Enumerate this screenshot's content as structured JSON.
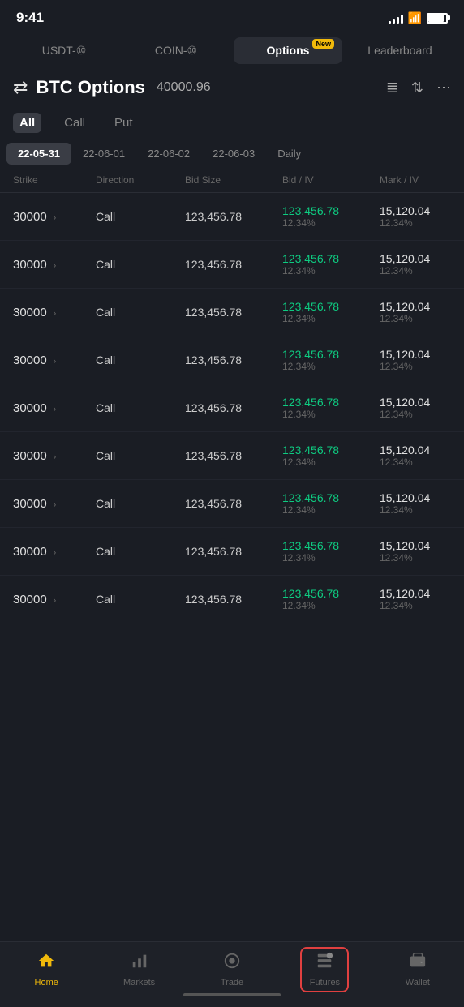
{
  "statusBar": {
    "time": "9:41",
    "signal": [
      3,
      5,
      8,
      11,
      14
    ],
    "battery": 85
  },
  "topTabs": [
    {
      "id": "usdt",
      "label": "USDT-⑩",
      "active": false,
      "badge": null
    },
    {
      "id": "coin",
      "label": "COIN-⑩",
      "active": false,
      "badge": null
    },
    {
      "id": "options",
      "label": "Options",
      "active": true,
      "badge": "New"
    },
    {
      "id": "leaderboard",
      "label": "Leaderboard",
      "active": false,
      "badge": null
    }
  ],
  "header": {
    "title": "BTC Options",
    "price": "40000.96"
  },
  "filterTabs": [
    {
      "label": "All",
      "active": true
    },
    {
      "label": "Call",
      "active": false
    },
    {
      "label": "Put",
      "active": false
    }
  ],
  "dateTabs": [
    {
      "label": "22-05-31",
      "active": true
    },
    {
      "label": "22-06-01",
      "active": false
    },
    {
      "label": "22-06-02",
      "active": false
    },
    {
      "label": "22-06-03",
      "active": false
    },
    {
      "label": "Daily",
      "active": false
    }
  ],
  "tableHeaders": [
    "Strike",
    "Direction",
    "Bid Size",
    "Bid / IV",
    "Mark / IV"
  ],
  "tableRows": [
    {
      "strike": "30000",
      "direction": "Call",
      "bidSize": "123,456.78",
      "bidIV": "123,456.78",
      "bidPct": "12.34%",
      "markIV": "15,120.04",
      "markPct": "12.34%"
    },
    {
      "strike": "30000",
      "direction": "Call",
      "bidSize": "123,456.78",
      "bidIV": "123,456.78",
      "bidPct": "12.34%",
      "markIV": "15,120.04",
      "markPct": "12.34%"
    },
    {
      "strike": "30000",
      "direction": "Call",
      "bidSize": "123,456.78",
      "bidIV": "123,456.78",
      "bidPct": "12.34%",
      "markIV": "15,120.04",
      "markPct": "12.34%"
    },
    {
      "strike": "30000",
      "direction": "Call",
      "bidSize": "123,456.78",
      "bidIV": "123,456.78",
      "bidPct": "12.34%",
      "markIV": "15,120.04",
      "markPct": "12.34%"
    },
    {
      "strike": "30000",
      "direction": "Call",
      "bidSize": "123,456.78",
      "bidIV": "123,456.78",
      "bidPct": "12.34%",
      "markIV": "15,120.04",
      "markPct": "12.34%"
    },
    {
      "strike": "30000",
      "direction": "Call",
      "bidSize": "123,456.78",
      "bidIV": "123,456.78",
      "bidPct": "12.34%",
      "markIV": "15,120.04",
      "markPct": "12.34%"
    },
    {
      "strike": "30000",
      "direction": "Call",
      "bidSize": "123,456.78",
      "bidIV": "123,456.78",
      "bidPct": "12.34%",
      "markIV": "15,120.04",
      "markPct": "12.34%"
    },
    {
      "strike": "30000",
      "direction": "Call",
      "bidSize": "123,456.78",
      "bidIV": "123,456.78",
      "bidPct": "12.34%",
      "markIV": "15,120.04",
      "markPct": "12.34%"
    },
    {
      "strike": "30000",
      "direction": "Call",
      "bidSize": "123,456.78",
      "bidIV": "123,456.78",
      "bidPct": "12.34%",
      "markIV": "15,120.04",
      "markPct": "12.34%"
    }
  ],
  "bottomNav": [
    {
      "id": "home",
      "label": "Home",
      "icon": "🏠",
      "active": true,
      "highlighted": false
    },
    {
      "id": "markets",
      "label": "Markets",
      "icon": "📊",
      "active": false,
      "highlighted": false
    },
    {
      "id": "trade",
      "label": "Trade",
      "icon": "🔄",
      "active": false,
      "highlighted": false
    },
    {
      "id": "futures",
      "label": "Futures",
      "icon": "📋",
      "active": false,
      "highlighted": true
    },
    {
      "id": "wallet",
      "label": "Wallet",
      "icon": "👛",
      "active": false,
      "highlighted": false
    }
  ]
}
